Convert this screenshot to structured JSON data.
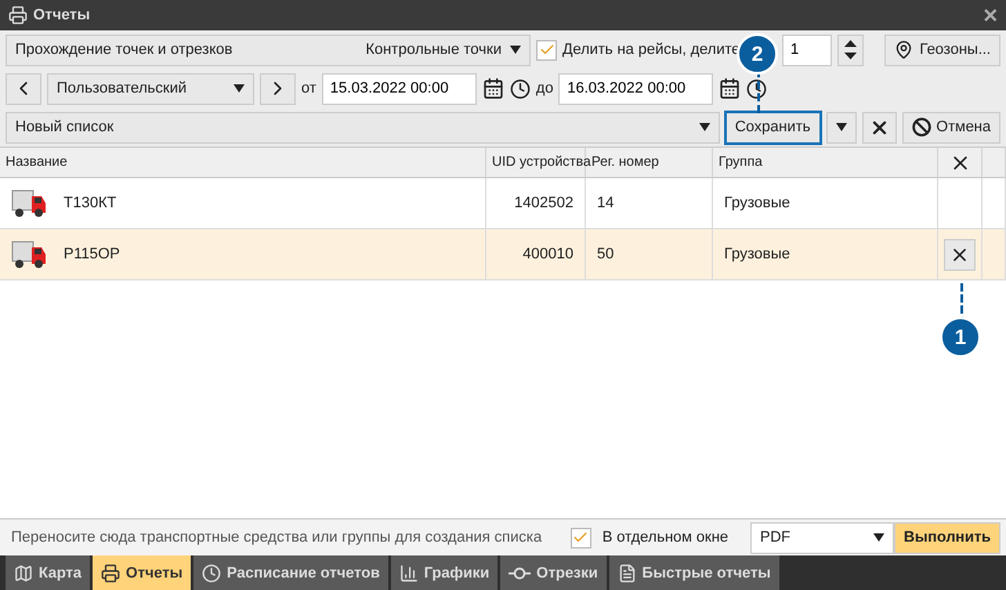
{
  "window": {
    "title": "Отчеты",
    "close": "×"
  },
  "report": {
    "name": "Прохождение точек и отрезков",
    "template": "Контрольные точки"
  },
  "split": {
    "label": "Делить на рейсы, делите",
    "checked": true,
    "value": "1"
  },
  "geozones_button": "Геозоны...",
  "period": {
    "preset": "Пользовательский",
    "from_label": "от",
    "from": "15.03.2022 00:00",
    "to_label": "до",
    "to": "16.03.2022 00:00"
  },
  "list": {
    "name": "Новый список",
    "save": "Сохранить",
    "cancel": "Отмена"
  },
  "table": {
    "columns": [
      "Название",
      "UID устройства",
      "Рег. номер",
      "Группа"
    ],
    "rows": [
      {
        "name": "Т130КТ",
        "uid": "1402502",
        "reg": "14",
        "group": "Грузовые",
        "selected": false
      },
      {
        "name": "Р115ОР",
        "uid": "400010",
        "reg": "50",
        "group": "Грузовые",
        "selected": true
      }
    ]
  },
  "callouts": [
    {
      "label": "1"
    },
    {
      "label": "2"
    }
  ],
  "footer": {
    "hint": "Переносите сюда транспортные средства или группы для создания списка",
    "separate_window": {
      "label": "В отдельном окне",
      "checked": true
    },
    "format": "PDF",
    "run": "Выполнить"
  },
  "tabs": [
    {
      "label": "Карта",
      "selected": false
    },
    {
      "label": "Отчеты",
      "selected": true
    },
    {
      "label": "Расписание отчетов",
      "selected": false
    },
    {
      "label": "Графики",
      "selected": false
    },
    {
      "label": "Отрезки",
      "selected": false
    },
    {
      "label": "Быстрые отчеты",
      "selected": false
    }
  ]
}
